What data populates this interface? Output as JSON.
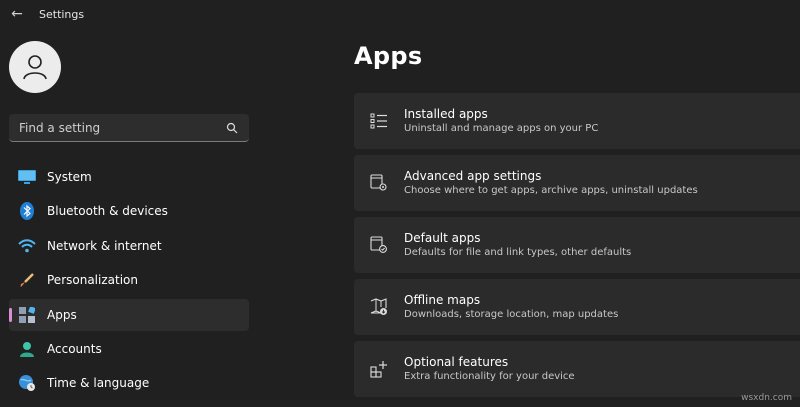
{
  "window": {
    "title": "Settings"
  },
  "search": {
    "placeholder": "Find a setting"
  },
  "sidebar": {
    "items": [
      {
        "label": "System"
      },
      {
        "label": "Bluetooth & devices"
      },
      {
        "label": "Network & internet"
      },
      {
        "label": "Personalization"
      },
      {
        "label": "Apps",
        "selected": true
      },
      {
        "label": "Accounts"
      },
      {
        "label": "Time & language"
      }
    ]
  },
  "main": {
    "title": "Apps",
    "cards": [
      {
        "title": "Installed apps",
        "subtitle": "Uninstall and manage apps on your PC"
      },
      {
        "title": "Advanced app settings",
        "subtitle": "Choose where to get apps, archive apps, uninstall updates"
      },
      {
        "title": "Default apps",
        "subtitle": "Defaults for file and link types, other defaults"
      },
      {
        "title": "Offline maps",
        "subtitle": "Downloads, storage location, map updates"
      },
      {
        "title": "Optional features",
        "subtitle": "Extra functionality for your device"
      }
    ]
  },
  "watermark": "wsxdn.com",
  "colors": {
    "background": "#202020",
    "card": "#2b2b2b",
    "accent": "#d98ed6"
  }
}
